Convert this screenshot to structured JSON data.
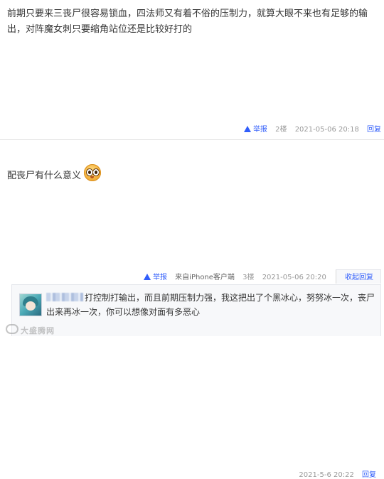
{
  "posts": [
    {
      "text": "前期只要来三丧尸很容易锁血，四法师又有着不俗的压制力，就算大眼不来也有足够的输出，对阵魔女刺只要缩角站位还是比较好打的",
      "report_label": "举报",
      "floor": "2楼",
      "time": "2021-05-06 20:18",
      "reply_label": "回复"
    },
    {
      "text": "配丧尸有什么意义",
      "emoji": "eyes-sparkle-emoji",
      "report_label": "举报",
      "client": "来自iPhone客户端",
      "floor": "3楼",
      "time": "2021-05-06 20:20",
      "collapse_label": "收起回复"
    }
  ],
  "lzl_reply": {
    "text": "打控制打输出，而且前期压制力强，我这把出了个黑冰心，努努冰一次，丧尸出来再冰一次，你可以想像对面有多恶心",
    "time": "2021-5-6 20:22",
    "reply_label": "回复"
  },
  "watermark": "大盛腾网",
  "colors": {
    "link": "#315efb",
    "meta": "#999999",
    "text": "#333333"
  }
}
